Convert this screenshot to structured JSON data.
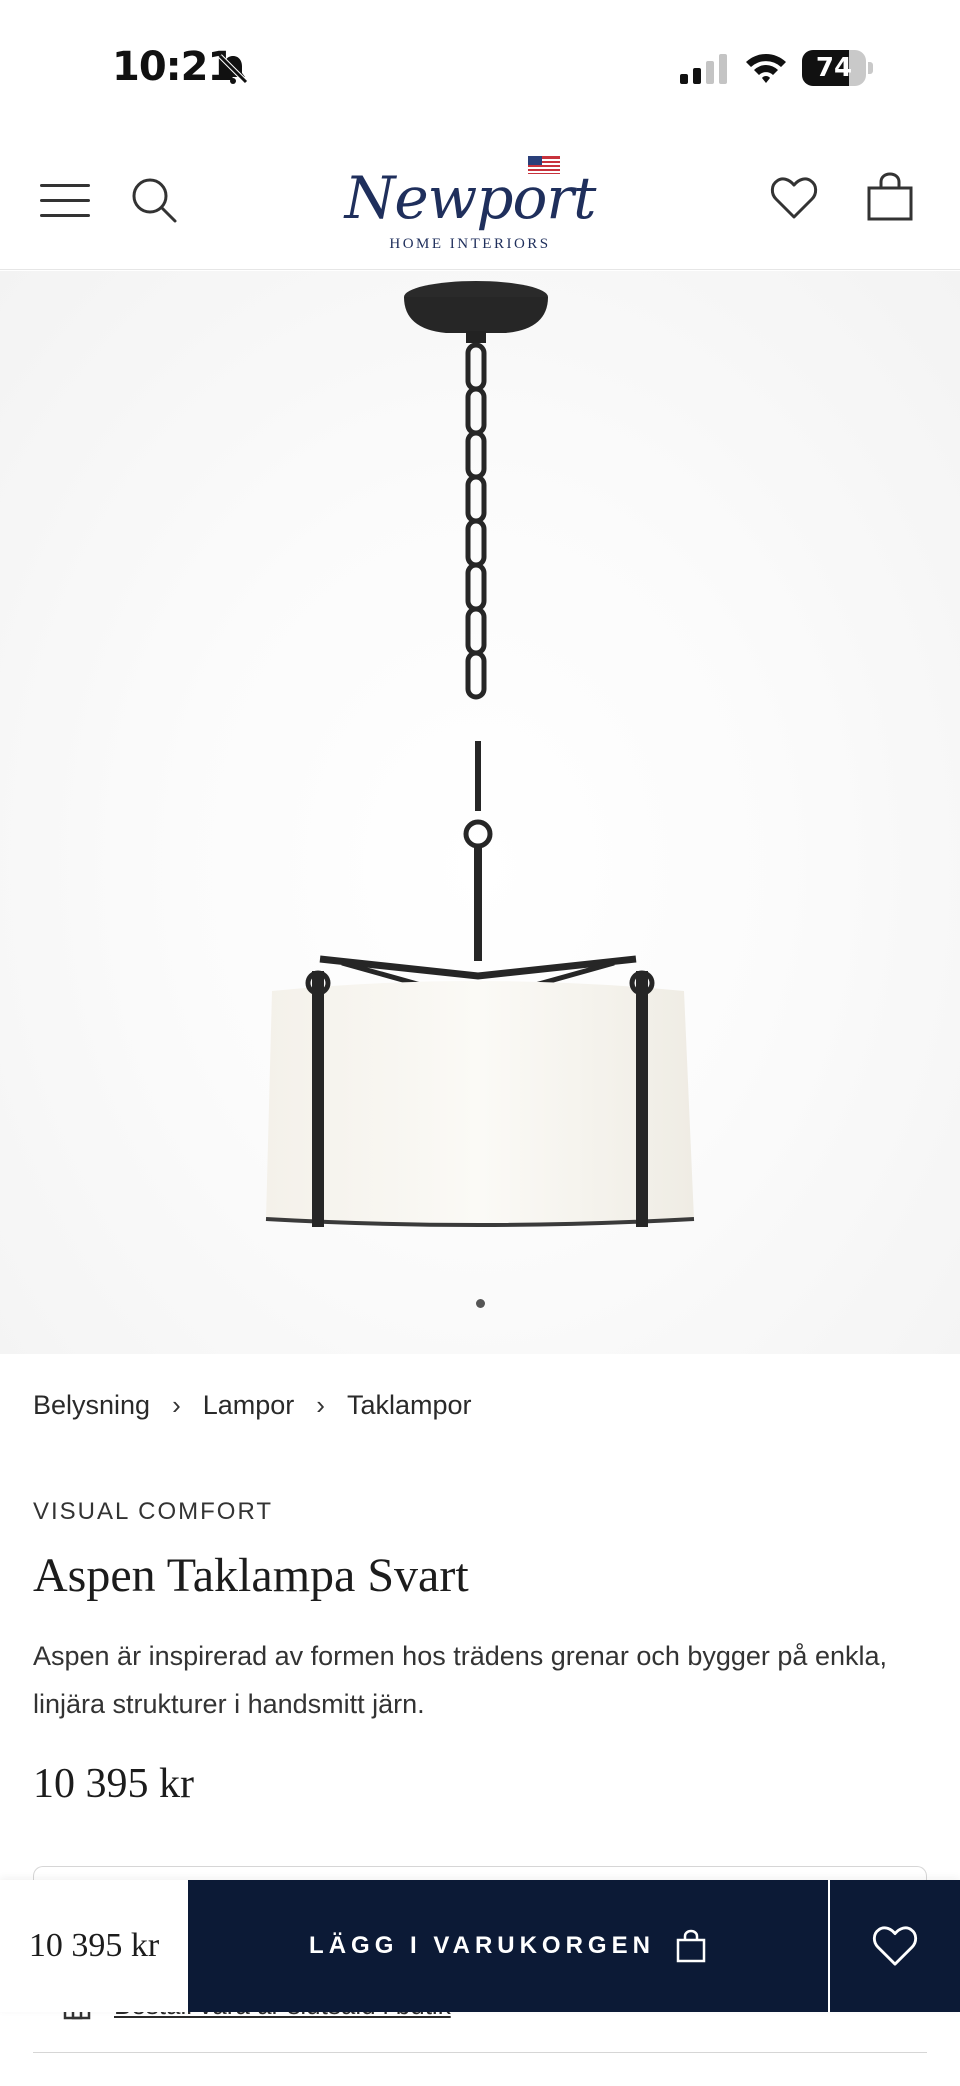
{
  "status_bar": {
    "time": "10:21",
    "battery_level": "74",
    "battery_fraction": 0.74,
    "icons": [
      "bell-slash-icon",
      "cellular-signal-icon",
      "wifi-icon",
      "battery-icon"
    ]
  },
  "header": {
    "logo_name": "Newport",
    "logo_subtitle": "HOME INTERIORS",
    "icons": [
      "menu-icon",
      "search-icon",
      "heart-icon",
      "shopping-bag-icon"
    ]
  },
  "gallery": {
    "image_subject": "pendant lamp with black iron frame and white linen drum shade",
    "pages": 1,
    "current_page": 1
  },
  "breadcrumb": [
    "Belysning",
    "Lampor",
    "Taklampor"
  ],
  "breadcrumb_separator": "›",
  "product": {
    "brand": "VISUAL COMFORT",
    "title": "Aspen Taklampa Svart",
    "description": "Aspen är inspirerad av formen hos trädens grenar och bygger på enkla, linjära strukturer i handsmitt järn.",
    "price": "10 395 kr"
  },
  "store": {
    "link_text": "Beställ vara är slutsåld i butik"
  },
  "sticky_bar": {
    "price": "10 395 kr",
    "add_to_cart_label": "LÄGG I VARUKORGEN"
  },
  "colors": {
    "navy": "#0c1a36",
    "logo_blue": "#1f2f5c"
  }
}
